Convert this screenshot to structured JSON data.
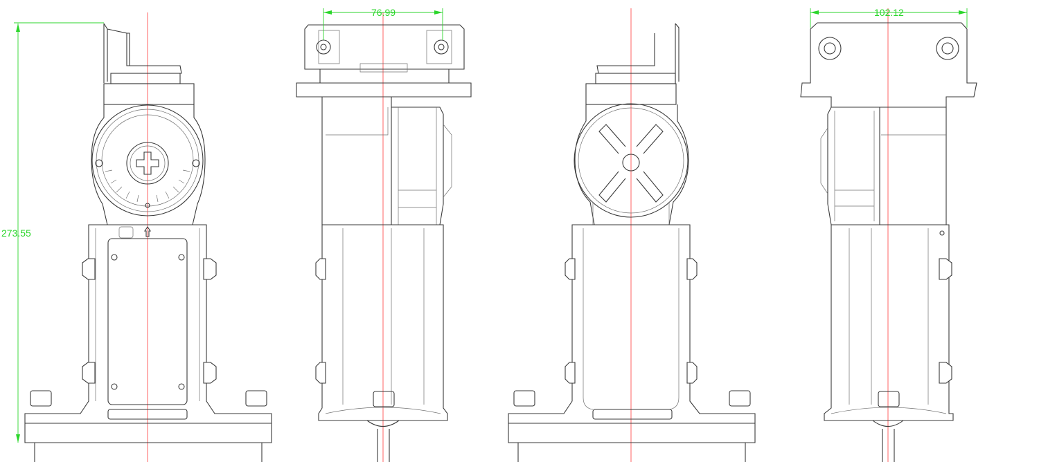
{
  "drawing": {
    "dimensions": [
      {
        "id": "height",
        "value": "273.55"
      },
      {
        "id": "side-width",
        "value": "76.99"
      },
      {
        "id": "top-width",
        "value": "102.12"
      }
    ],
    "views": [
      "front",
      "side-right",
      "back",
      "side-left"
    ],
    "colors": {
      "outline": "#3a3a3a",
      "centerline": "#ff3b3b",
      "dimension": "#2bd62b",
      "background": "#ffffff"
    }
  }
}
